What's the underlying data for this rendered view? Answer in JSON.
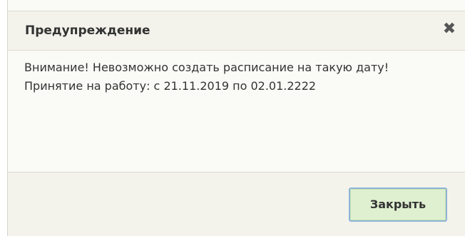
{
  "dialog": {
    "title": "Предупреждение",
    "close_icon": "close-icon",
    "message_line_1": "Внимание! Невозможно создать расписание на такую дату!",
    "message_line_2": "Принятие на работу: с 21.11.2019 по 02.01.2222",
    "close_button_label": "Закрыть"
  },
  "colors": {
    "header_bg": "#f3f3ec",
    "body_bg": "#fafaf6",
    "button_bg": "#dff0d0",
    "button_border": "#8db4d6"
  }
}
